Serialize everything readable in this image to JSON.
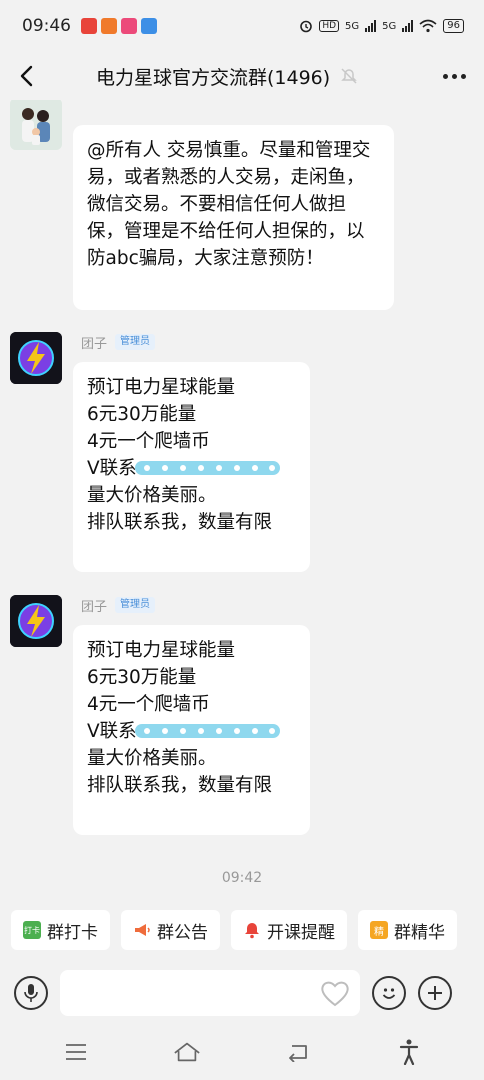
{
  "status_bar": {
    "time": "09:46",
    "hd_label": "HD",
    "net1": "5G",
    "net2": "5G",
    "battery": "96",
    "app_colors": [
      "#e8443a",
      "#f07a2b",
      "#ec4a7a",
      "#3d8fe6"
    ]
  },
  "header": {
    "title": "电力星球官方交流群(1496)"
  },
  "messages": [
    {
      "sender": "",
      "badge": "",
      "text": "@所有人 交易慎重。尽量和管理交易，或者熟悉的人交易，走闲鱼，微信交易。不要相信任何人做担保，管理是不给任何人担保的，以防abc骗局，大家注意预防！"
    },
    {
      "sender": "团子",
      "badge": "管理员",
      "line1": "预订电力星球能量",
      "line2": "6元30万能量",
      "line3": "4元一个爬墙币",
      "line4": "V联系",
      "line5": "量大价格美丽。",
      "line6": "排队联系我，数量有限"
    },
    {
      "sender": "团子",
      "badge": "管理员",
      "line1": "预订电力星球能量",
      "line2": "6元30万能量",
      "line3": "4元一个爬墙币",
      "line4": "V联系",
      "line5": "量大价格美丽。",
      "line6": "排队联系我，数量有限"
    }
  ],
  "time_divider": "09:42",
  "quick_actions": [
    {
      "label": "群打卡",
      "icon": "checkin-icon",
      "icon_text": "打卡",
      "color": "#4caf50"
    },
    {
      "label": "群公告",
      "icon": "megaphone-icon",
      "icon_text": "",
      "color": "#ef6c3c"
    },
    {
      "label": "开课提醒",
      "icon": "bell-icon",
      "icon_text": "",
      "color": "#e8443a"
    },
    {
      "label": "群精华",
      "icon": "essence-icon",
      "icon_text": "精",
      "color": "#f5a623"
    }
  ],
  "input": {
    "placeholder": ""
  },
  "accent_colors": {
    "badge_text": "#4a8fd8",
    "avatar_bg": "#12121a",
    "bolt": "#f5c518",
    "blur": "#62c6e8"
  }
}
